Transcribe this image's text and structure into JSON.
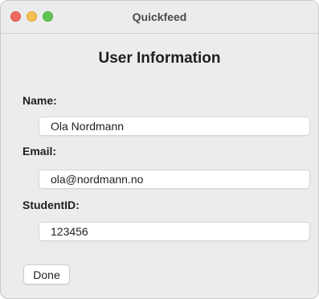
{
  "window": {
    "title": "Quickfeed"
  },
  "form": {
    "heading": "User Information",
    "fields": [
      {
        "label": "Name:",
        "value": "Ola Nordmann"
      },
      {
        "label": "Email:",
        "value": "ola@nordmann.no"
      },
      {
        "label": "StudentID:",
        "value": "123456"
      }
    ],
    "done_label": "Done"
  },
  "colors": {
    "close": "#ed6a5e",
    "minimize": "#f5bf4f",
    "zoom": "#61c554",
    "window_background": "#ececec"
  }
}
